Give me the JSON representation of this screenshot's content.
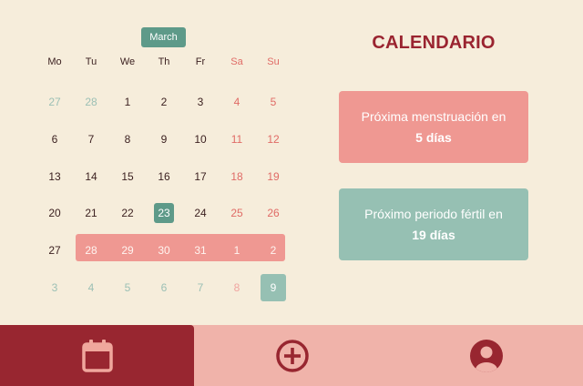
{
  "calendar": {
    "month": "March",
    "weekdays": [
      "Mo",
      "Tu",
      "We",
      "Th",
      "Fr",
      "Sa",
      "Su"
    ],
    "weeks": [
      [
        {
          "d": "27",
          "m": "o"
        },
        {
          "d": "28",
          "m": "o"
        },
        {
          "d": "1",
          "m": "c"
        },
        {
          "d": "2",
          "m": "c"
        },
        {
          "d": "3",
          "m": "c"
        },
        {
          "d": "4",
          "m": "c"
        },
        {
          "d": "5",
          "m": "c"
        }
      ],
      [
        {
          "d": "6",
          "m": "c"
        },
        {
          "d": "7",
          "m": "c"
        },
        {
          "d": "8",
          "m": "c"
        },
        {
          "d": "9",
          "m": "c"
        },
        {
          "d": "10",
          "m": "c"
        },
        {
          "d": "11",
          "m": "c"
        },
        {
          "d": "12",
          "m": "c"
        }
      ],
      [
        {
          "d": "13",
          "m": "c"
        },
        {
          "d": "14",
          "m": "c"
        },
        {
          "d": "15",
          "m": "c"
        },
        {
          "d": "16",
          "m": "c"
        },
        {
          "d": "17",
          "m": "c"
        },
        {
          "d": "18",
          "m": "c"
        },
        {
          "d": "19",
          "m": "c"
        }
      ],
      [
        {
          "d": "20",
          "m": "c"
        },
        {
          "d": "21",
          "m": "c"
        },
        {
          "d": "22",
          "m": "c"
        },
        {
          "d": "23",
          "m": "c",
          "s": "today"
        },
        {
          "d": "24",
          "m": "c"
        },
        {
          "d": "25",
          "m": "c"
        },
        {
          "d": "26",
          "m": "c"
        }
      ],
      [
        {
          "d": "27",
          "m": "c"
        },
        {
          "d": "28",
          "m": "c",
          "s": "period"
        },
        {
          "d": "29",
          "m": "c",
          "s": "period"
        },
        {
          "d": "30",
          "m": "c",
          "s": "period"
        },
        {
          "d": "31",
          "m": "c",
          "s": "period"
        },
        {
          "d": "1",
          "m": "o",
          "s": "period"
        },
        {
          "d": "2",
          "m": "o",
          "s": "period"
        }
      ],
      [
        {
          "d": "3",
          "m": "o"
        },
        {
          "d": "4",
          "m": "o"
        },
        {
          "d": "5",
          "m": "o"
        },
        {
          "d": "6",
          "m": "o"
        },
        {
          "d": "7",
          "m": "o"
        },
        {
          "d": "8",
          "m": "o"
        },
        {
          "d": "9",
          "m": "o",
          "s": "fertile"
        }
      ]
    ]
  },
  "header": {
    "title": "CALENDARIO"
  },
  "cards": {
    "period": {
      "line1": "Próxima menstruación en",
      "line2": "5 días"
    },
    "fertile": {
      "line1": "Próximo periodo fértil en",
      "line2": "19 días"
    }
  },
  "nav": {
    "items": [
      {
        "icon": "calendar-icon",
        "active": true
      },
      {
        "icon": "plus-circle-icon",
        "active": false
      },
      {
        "icon": "user-circle-icon",
        "active": false
      }
    ]
  },
  "colors": {
    "background": "#f6eddb",
    "accent_red": "#982630",
    "period_pink": "#ef9892",
    "fertile_green": "#96c0b3",
    "today_green": "#5e9a89",
    "navbar_pink": "#f0b3aa"
  }
}
